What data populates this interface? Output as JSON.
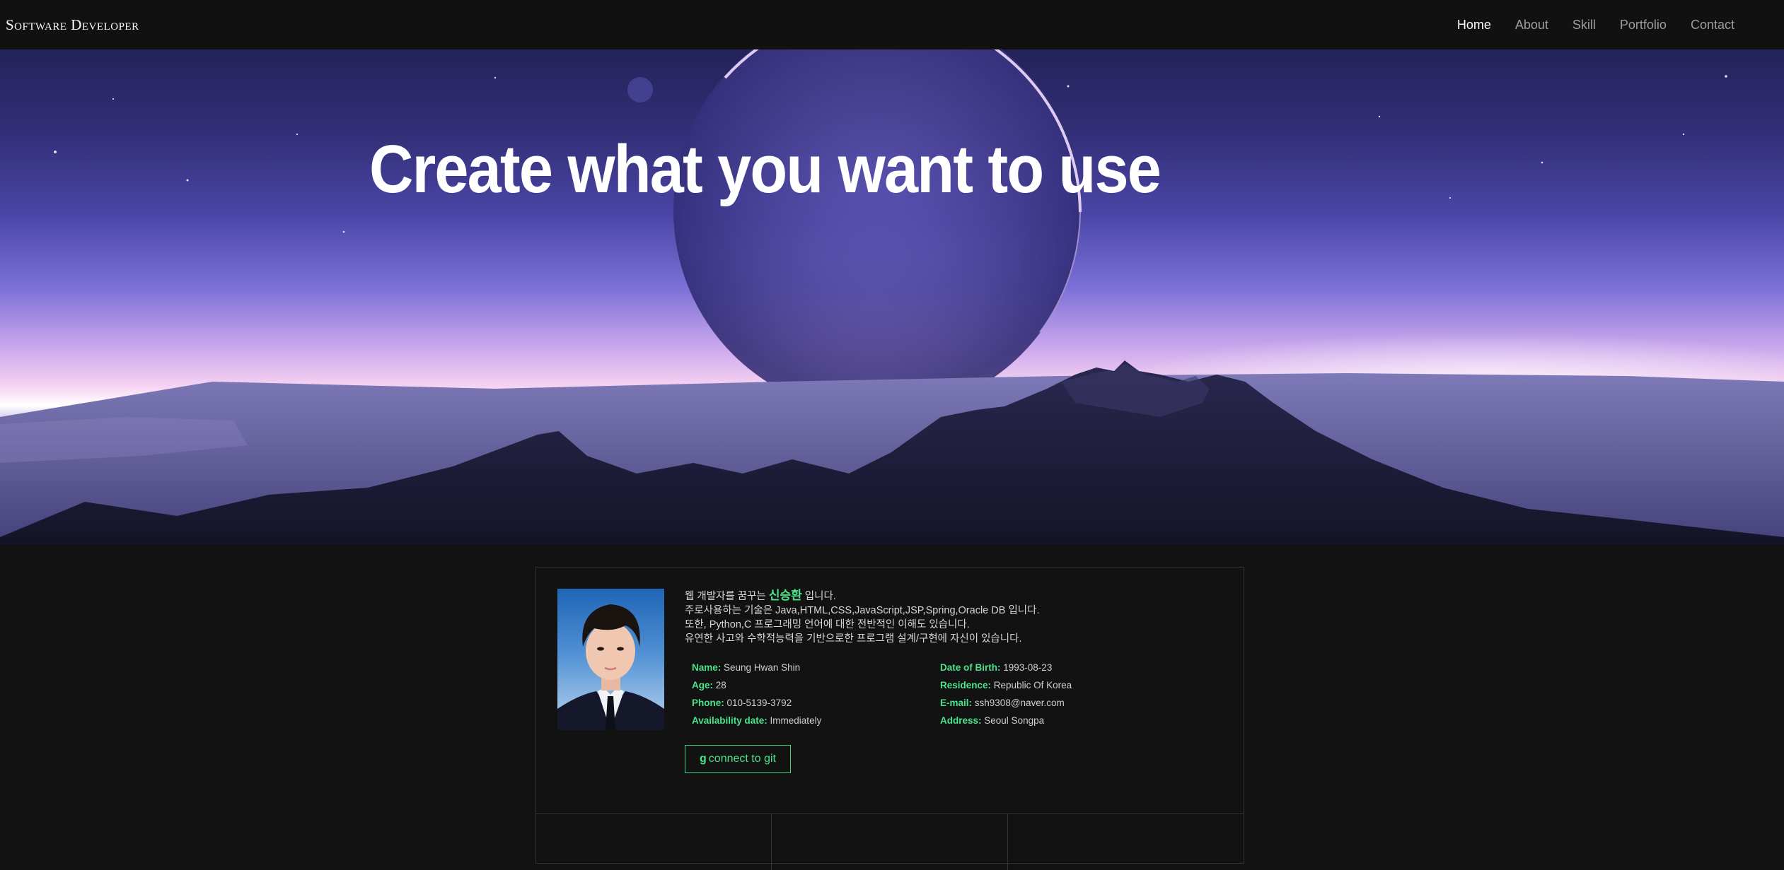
{
  "navbar": {
    "brand": "Software Developer",
    "links": [
      {
        "label": "Home",
        "active": true
      },
      {
        "label": "About",
        "active": false
      },
      {
        "label": "Skill",
        "active": false
      },
      {
        "label": "Portfolio",
        "active": false
      },
      {
        "label": "Contact",
        "active": false
      }
    ]
  },
  "hero": {
    "title": "Create what you want to use"
  },
  "profile": {
    "intro": {
      "line1_pre": "웹 개발자를 꿈꾸는",
      "line1_name": "신승환",
      "line1_post": "입니다.",
      "line2": "주로사용하는 기술은 Java,HTML,CSS,JavaScript,JSP,Spring,Oracle DB 입니다.",
      "line3": "또한, Python,C 프로그래밍 언어에 대한 전반적인 이해도 있습니다.",
      "line4": "유연한 사고와 수학적능력을 기반으로한 프로그램 설계/구현에 자신이 있습니다."
    },
    "details": [
      {
        "key": "Name:",
        "value": "Seung Hwan Shin"
      },
      {
        "key": "Date of Birth:",
        "value": "1993-08-23"
      },
      {
        "key": "Age:",
        "value": "28"
      },
      {
        "key": "Residence:",
        "value": "Republic Of Korea"
      },
      {
        "key": "Phone:",
        "value": "010-5139-3792"
      },
      {
        "key": "E-mail:",
        "value": "ssh9308@naver.com"
      },
      {
        "key": "Availability date:",
        "value": "Immediately"
      },
      {
        "key": "Address:",
        "value": "Seoul Songpa"
      }
    ],
    "git_button": {
      "icon": "git-icon",
      "label": "connect to git"
    }
  },
  "colors": {
    "accent": "#4ae38a",
    "background": "#121212",
    "navbar": "#111111"
  }
}
